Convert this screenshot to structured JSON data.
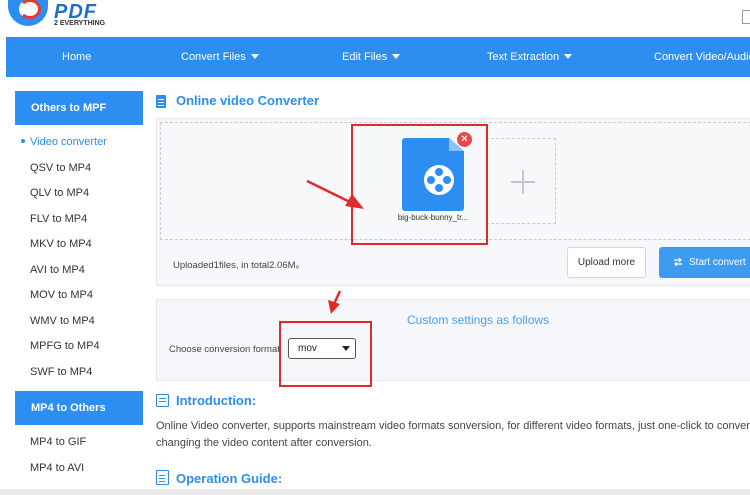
{
  "header": {
    "logo_text": "PDF",
    "logo_sub": "2 EVERYTHING"
  },
  "nav": {
    "items": [
      {
        "label": "Home"
      },
      {
        "label": "Convert Files"
      },
      {
        "label": "Edit Files"
      },
      {
        "label": "Text Extraction"
      },
      {
        "label": "Convert Video/Audio"
      }
    ]
  },
  "sidebar": {
    "group1_title": "Others to MPF",
    "group1_items": [
      {
        "label": "Video converter"
      },
      {
        "label": "QSV to MP4"
      },
      {
        "label": "QLV to MP4"
      },
      {
        "label": "FLV to MP4"
      },
      {
        "label": "MKV to MP4"
      },
      {
        "label": "AVI to MP4"
      },
      {
        "label": "MOV to MP4"
      },
      {
        "label": "WMV to MP4"
      },
      {
        "label": "MPFG to MP4"
      },
      {
        "label": "SWF to MP4"
      }
    ],
    "group2_title": "MP4 to Others",
    "group2_items": [
      {
        "label": "MP4 to GIF"
      },
      {
        "label": "MP4 to AVI"
      }
    ]
  },
  "main": {
    "section_title": "Online video Converter",
    "file": {
      "name": "big-buck-bunny_tr...",
      "remove_symbol": "×"
    },
    "upload_status": "Uploaded1files, in total2.06M。",
    "upload_more_label": "Upload more",
    "start_label": "Start convert",
    "custom_settings_title": "Custom settings as follows",
    "format_label": "Choose conversion format",
    "format_value": "mov",
    "intro_title": "Introduction:",
    "intro_line1": "Online Video converter, supports mainstream video formats sonversion, for different video formats, just one-click to convert w",
    "intro_line2": "changing the video content after conversion.",
    "guide_title": "Operation Guide:"
  },
  "colors": {
    "accent": "#2b8ef0",
    "annotation_red": "#e12a2a"
  },
  "icons": [
    "document-icon",
    "video-file-icon",
    "remove-icon",
    "add-file-icon",
    "swap-icon",
    "introduction-icon",
    "guide-icon",
    "chevron-down-icon"
  ]
}
